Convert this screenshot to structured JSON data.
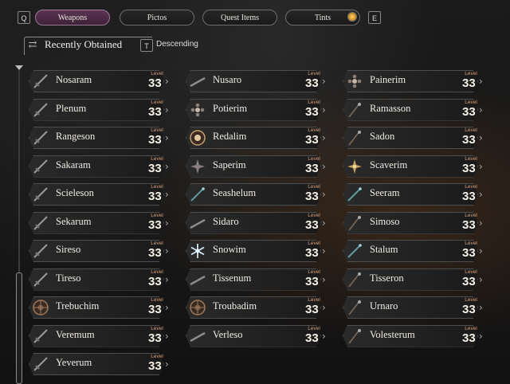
{
  "tabs": {
    "prev_key": "Q",
    "next_key": "E",
    "items": [
      "Weapons",
      "Pictos",
      "Quest Items",
      "Tints"
    ],
    "active": "Weapons"
  },
  "sort": {
    "label": "Recently Obtained",
    "key": "T",
    "order": "Descending"
  },
  "level_label": "Level",
  "weapons": [
    {
      "name": "Nosaram",
      "level": "33",
      "icon": "sword-icon"
    },
    {
      "name": "Nusaro",
      "level": "33",
      "icon": "blade-icon"
    },
    {
      "name": "Painerim",
      "level": "33",
      "icon": "ornate-flower-icon"
    },
    {
      "name": "Plenum",
      "level": "33",
      "icon": "sword-icon"
    },
    {
      "name": "Potierim",
      "level": "33",
      "icon": "ornate-flower-icon"
    },
    {
      "name": "Ramasson",
      "level": "33",
      "icon": "staff-icon"
    },
    {
      "name": "Rangeson",
      "level": "33",
      "icon": "sword-icon"
    },
    {
      "name": "Redalim",
      "level": "33",
      "icon": "sun-emblem-icon"
    },
    {
      "name": "Sadon",
      "level": "33",
      "icon": "staff-icon"
    },
    {
      "name": "Sakaram",
      "level": "33",
      "icon": "sword-icon"
    },
    {
      "name": "Saperim",
      "level": "33",
      "icon": "star-flower-icon"
    },
    {
      "name": "Scaverim",
      "level": "33",
      "icon": "gold-star-icon"
    },
    {
      "name": "Scieleson",
      "level": "33",
      "icon": "curved-sword-icon"
    },
    {
      "name": "Seashelum",
      "level": "33",
      "icon": "teal-staff-icon"
    },
    {
      "name": "Seeram",
      "level": "33",
      "icon": "teal-staff-icon"
    },
    {
      "name": "Sekarum",
      "level": "33",
      "icon": "sword-icon"
    },
    {
      "name": "Sidaro",
      "level": "33",
      "icon": "blade-icon"
    },
    {
      "name": "Simoso",
      "level": "33",
      "icon": "staff-icon"
    },
    {
      "name": "Sireso",
      "level": "33",
      "icon": "sword-icon"
    },
    {
      "name": "Snowim",
      "level": "33",
      "icon": "snowflake-icon"
    },
    {
      "name": "Stalum",
      "level": "33",
      "icon": "teal-staff-icon"
    },
    {
      "name": "Tireso",
      "level": "33",
      "icon": "sword-icon"
    },
    {
      "name": "Tissenum",
      "level": "33",
      "icon": "blade-icon"
    },
    {
      "name": "Tisseron",
      "level": "33",
      "icon": "staff-icon"
    },
    {
      "name": "Trebuchim",
      "level": "33",
      "icon": "wheel-emblem-icon"
    },
    {
      "name": "Troubadim",
      "level": "33",
      "icon": "wheel-emblem-icon"
    },
    {
      "name": "Urnaro",
      "level": "33",
      "icon": "staff-icon"
    },
    {
      "name": "Veremum",
      "level": "33",
      "icon": "sword-icon"
    },
    {
      "name": "Verleso",
      "level": "33",
      "icon": "blade-icon"
    },
    {
      "name": "Volesterum",
      "level": "33",
      "icon": "staff-icon"
    },
    {
      "name": "Yeverum",
      "level": "33",
      "icon": "sword-icon"
    }
  ],
  "colors": {
    "active_tab": "#5b3553",
    "level_label": "#d8a07a",
    "card_border": "#4e4e4e"
  }
}
